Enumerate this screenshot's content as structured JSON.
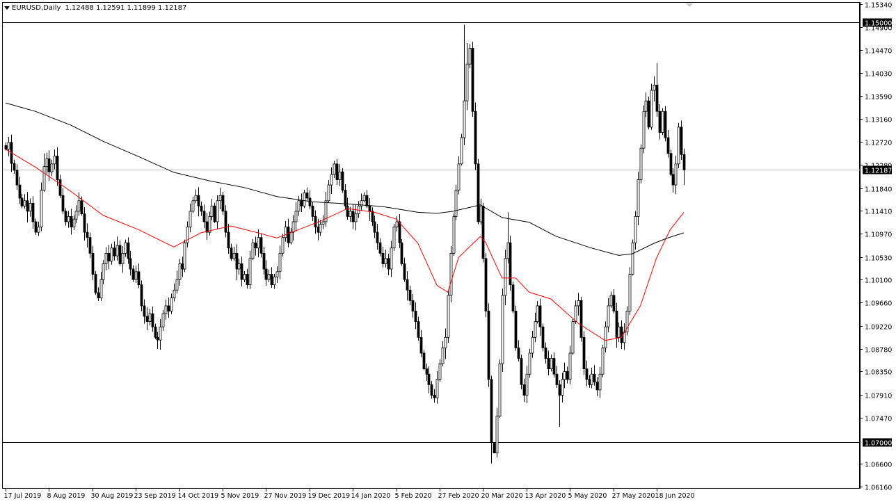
{
  "header": {
    "symbol": "EURUSD,Daily",
    "ohlc": "1.12488 1.12591 1.11899 1.12187",
    "menu_icon": "triangle-down-icon"
  },
  "colors": {
    "background": "#ffffff",
    "candle": "#000000",
    "ma_fast": "#ff0000",
    "ma_slow": "#000000",
    "price_line": "#c0c0c0",
    "label_bg": "#000000",
    "label_text": "#ffffff"
  },
  "chart_data": {
    "type": "candlestick",
    "title": "EURUSD,Daily",
    "ylim": [
      1.0616,
      1.1534
    ],
    "y_ticks": [
      "1.15340",
      "1.14900",
      "1.14470",
      "1.14030",
      "1.13590",
      "1.13160",
      "1.12720",
      "1.12280",
      "1.11840",
      "1.11410",
      "1.10970",
      "1.10530",
      "1.10100",
      "1.09660",
      "1.09220",
      "1.08780",
      "1.08350",
      "1.07910",
      "1.07470",
      "1.06600",
      "1.06160"
    ],
    "x_labels": [
      "17 Jul 2019",
      "8 Aug 2019",
      "30 Aug 2019",
      "23 Sep 2019",
      "14 Oct 2019",
      "5 Nov 2019",
      "27 Nov 2019",
      "19 Dec 2019",
      "14 Jan 2020",
      "5 Feb 2020",
      "27 Feb 2020",
      "20 Mar 2020",
      "13 Apr 2020",
      "5 May 2020",
      "27 May 2020",
      "18 Jun 2020"
    ],
    "x_label_every_bars": 16,
    "horizontal_lines": [
      {
        "price": 1.15,
        "label": "1.15000"
      },
      {
        "price": 1.07,
        "label": "1.07000"
      }
    ],
    "current_price": {
      "price": 1.12187,
      "label": "1.12187"
    },
    "first_open": 1.1265,
    "closes": [
      1.1258,
      1.1271,
      1.1231,
      1.1218,
      1.119,
      1.1165,
      1.115,
      1.116,
      1.114,
      1.1155,
      1.112,
      1.11,
      1.111,
      1.118,
      1.1225,
      1.124,
      1.1215,
      1.123,
      1.1245,
      1.12,
      1.117,
      1.114,
      1.112,
      1.113,
      1.111,
      1.1125,
      1.114,
      1.116,
      1.1135,
      1.11,
      1.109,
      1.106,
      1.102,
      1.0985,
      1.0975,
      1.101,
      1.104,
      1.106,
      1.1045,
      1.107,
      1.1055,
      1.1075,
      1.104,
      1.106,
      1.108,
      1.105,
      1.103,
      1.101,
      1.1025,
      1.1,
      1.096,
      1.094,
      1.093,
      1.0945,
      1.092,
      1.09,
      1.0895,
      1.092,
      1.0945,
      1.096,
      1.095,
      1.0975,
      1.099,
      1.101,
      1.104,
      1.103,
      1.108,
      1.111,
      1.114,
      1.116,
      1.117,
      1.115,
      1.114,
      1.112,
      1.11,
      1.113,
      1.115,
      1.112,
      1.116,
      1.117,
      1.114,
      1.11,
      1.107,
      1.105,
      1.106,
      1.103,
      1.104,
      1.101,
      1.102,
      1.1,
      1.105,
      1.108,
      1.107,
      1.109,
      1.106,
      1.103,
      1.101,
      1.102,
      1.1,
      1.1015,
      1.1025,
      1.106,
      1.109,
      1.111,
      1.108,
      1.11,
      1.112,
      1.114,
      1.116,
      1.115,
      1.1175,
      1.1165,
      1.115,
      1.113,
      1.111,
      1.11,
      1.1115,
      1.112,
      1.116,
      1.119,
      1.121,
      1.123,
      1.12,
      1.1215,
      1.118,
      1.115,
      1.113,
      1.114,
      1.112,
      1.1135,
      1.115,
      1.116,
      1.117,
      1.115,
      1.114,
      1.112,
      1.11,
      1.108,
      1.106,
      1.104,
      1.105,
      1.103,
      1.107,
      1.111,
      1.112,
      1.108,
      1.104,
      1.101,
      1.099,
      1.097,
      1.095,
      1.093,
      1.09,
      1.087,
      1.084,
      1.083,
      1.081,
      1.079,
      1.0785,
      1.082,
      1.085,
      1.088,
      1.09,
      1.098,
      1.106,
      1.113,
      1.118,
      1.123,
      1.128,
      1.135,
      1.142,
      1.145,
      1.133,
      1.123,
      1.112,
      1.115,
      1.105,
      1.095,
      1.082,
      1.07,
      1.068,
      1.075,
      1.085,
      1.098,
      1.105,
      1.108,
      1.1,
      1.095,
      1.088,
      1.086,
      1.081,
      1.079,
      1.083,
      1.087,
      1.09,
      1.093,
      1.096,
      1.092,
      1.088,
      1.086,
      1.084,
      1.086,
      1.083,
      1.081,
      1.079,
      1.082,
      1.0835,
      1.082,
      1.087,
      1.093,
      1.096,
      1.097,
      1.09,
      1.084,
      1.082,
      1.081,
      1.083,
      1.0815,
      1.08,
      1.083,
      1.088,
      1.092,
      1.096,
      1.098,
      1.095,
      1.09,
      1.092,
      1.089,
      1.091,
      1.095,
      1.102,
      1.108,
      1.113,
      1.12,
      1.126,
      1.133,
      1.135,
      1.13,
      1.137,
      1.138,
      1.133,
      1.129,
      1.133,
      1.128,
      1.125,
      1.121,
      1.119,
      1.123,
      1.13,
      1.1248,
      1.12187
    ],
    "high_overrides": {
      "169": 1.1495,
      "170": 1.146,
      "180": 1.0636,
      "185": 1.1138,
      "240": 1.1422,
      "122": 1.1239,
      "14": 1.125,
      "250": 1.12591
    },
    "low_overrides": {
      "180": 1.0636,
      "179": 1.066,
      "204": 1.073,
      "250": 1.11899,
      "56": 1.0878
    },
    "ma_fast": {
      "name": "MA fast (red)",
      "points": [
        [
          0,
          1.1258
        ],
        [
          11,
          1.1224
        ],
        [
          24,
          1.1178
        ],
        [
          36,
          1.1132
        ],
        [
          49,
          1.1105
        ],
        [
          62,
          1.1072
        ],
        [
          72,
          1.1099
        ],
        [
          83,
          1.1112
        ],
        [
          93,
          1.1099
        ],
        [
          100,
          1.1089
        ],
        [
          108,
          1.1105
        ],
        [
          116,
          1.1121
        ],
        [
          126,
          1.1145
        ],
        [
          136,
          1.1138
        ],
        [
          144,
          1.1125
        ],
        [
          152,
          1.1079
        ],
        [
          159,
          1.0999
        ],
        [
          163,
          1.0986
        ],
        [
          167,
          1.1052
        ],
        [
          175,
          1.1092
        ],
        [
          177,
          1.108
        ],
        [
          183,
          1.1013
        ],
        [
          188,
          1.1013
        ],
        [
          193,
          1.0986
        ],
        [
          201,
          1.0973
        ],
        [
          211,
          1.0927
        ],
        [
          221,
          1.0894
        ],
        [
          227,
          1.09
        ],
        [
          234,
          1.096
        ],
        [
          240,
          1.1052
        ],
        [
          245,
          1.1105
        ],
        [
          250,
          1.1138
        ]
      ]
    },
    "ma_slow": {
      "name": "MA slow (black)",
      "points": [
        [
          0,
          1.1346
        ],
        [
          11,
          1.133
        ],
        [
          24,
          1.1304
        ],
        [
          36,
          1.1273
        ],
        [
          49,
          1.1244
        ],
        [
          62,
          1.1214
        ],
        [
          75,
          1.1198
        ],
        [
          88,
          1.1185
        ],
        [
          100,
          1.1168
        ],
        [
          113,
          1.1158
        ],
        [
          126,
          1.1154
        ],
        [
          139,
          1.1149
        ],
        [
          152,
          1.1138
        ],
        [
          159,
          1.1136
        ],
        [
          165,
          1.114
        ],
        [
          175,
          1.1152
        ],
        [
          183,
          1.1128
        ],
        [
          193,
          1.1119
        ],
        [
          203,
          1.1092
        ],
        [
          216,
          1.107
        ],
        [
          226,
          1.1056
        ],
        [
          231,
          1.1059
        ],
        [
          239,
          1.1079
        ],
        [
          244,
          1.1089
        ],
        [
          250,
          1.1099
        ]
      ]
    }
  }
}
